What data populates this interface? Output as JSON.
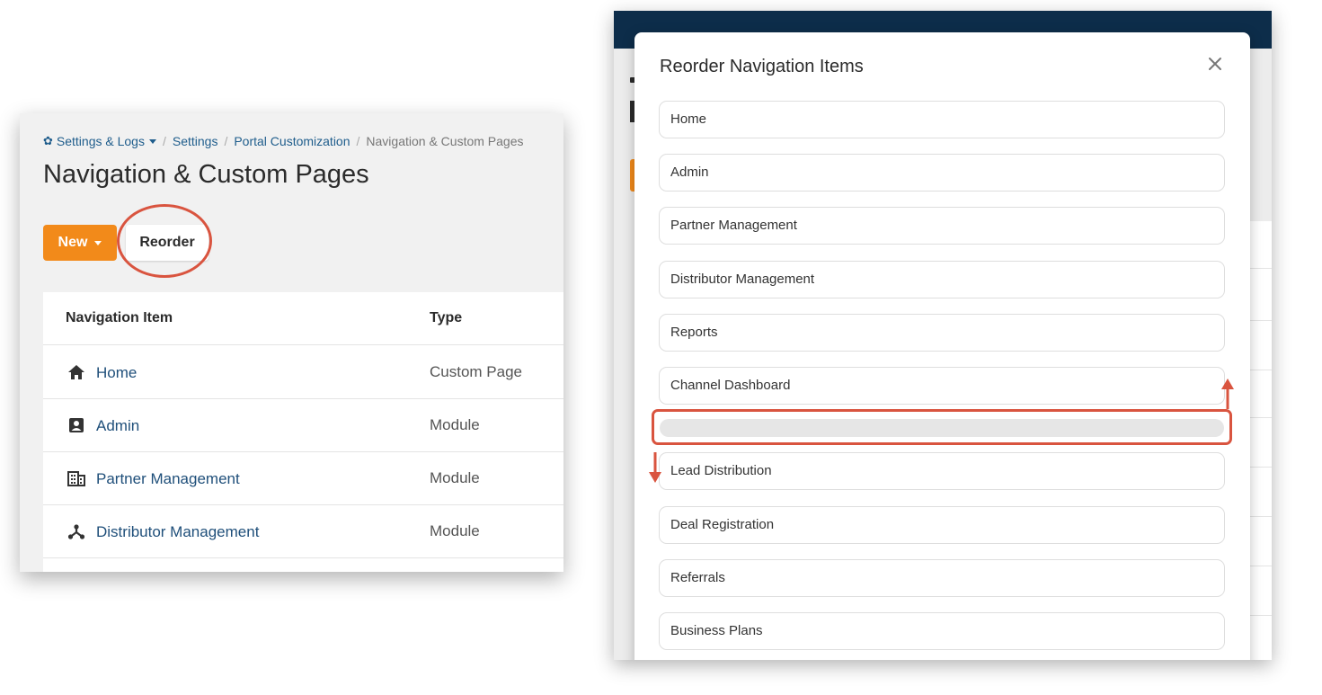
{
  "left": {
    "breadcrumb": {
      "root": "Settings & Logs",
      "settings": "Settings",
      "portal": "Portal Customization",
      "current": "Navigation & Custom Pages"
    },
    "page_title": "Navigation & Custom Pages",
    "new_button": "New",
    "reorder_button": "Reorder",
    "table": {
      "col_item": "Navigation Item",
      "col_type": "Type",
      "rows": [
        {
          "name": "Home",
          "type": "Custom Page",
          "icon": "home-icon"
        },
        {
          "name": "Admin",
          "type": "Module",
          "icon": "admin-card-icon"
        },
        {
          "name": "Partner Management",
          "type": "Module",
          "icon": "building-icon"
        },
        {
          "name": "Distributor Management",
          "type": "Module",
          "icon": "network-icon"
        }
      ]
    }
  },
  "modal": {
    "title": "Reorder Navigation Items",
    "items": [
      "Home",
      "Admin",
      "Partner Management",
      "Distributor Management",
      "Reports",
      "Channel Dashboard",
      "Lead Distribution",
      "Deal Registration",
      "Referrals",
      "Business Plans"
    ]
  },
  "colors": {
    "accent_orange": "#f28a1a",
    "link_blue": "#1f4f7a",
    "annotation_red": "#d9543f",
    "topbar_navy": "#0d2d4a"
  }
}
